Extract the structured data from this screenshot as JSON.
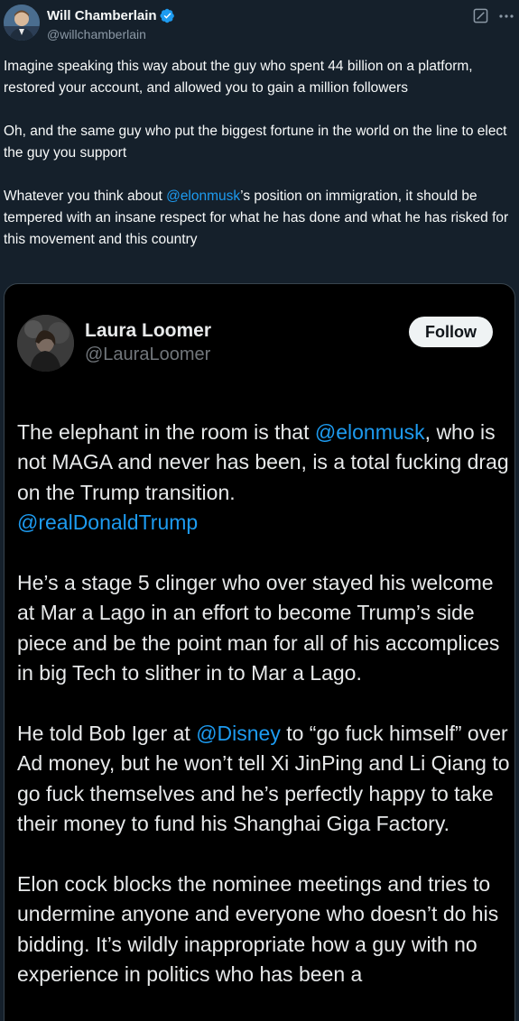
{
  "author": {
    "name": "Will Chamberlain",
    "handle": "@willchamberlain",
    "verified": true,
    "verified_color": "#1d9bf0"
  },
  "header_icons": [
    "grok-icon",
    "more-icon"
  ],
  "post": {
    "p1": "Imagine speaking this way about the guy who spent 44 billion on a platform, restored your account, and allowed you to gain a million followers",
    "p2": "Oh, and the same guy who put the biggest fortune in the world on the line to elect the guy you support",
    "p3_before": "Whatever you think about ",
    "p3_mention": "@elonmusk",
    "p3_after": "’s position on immigration, it should be tempered with an insane respect for what he has done and what he has risked for this movement and this country"
  },
  "embedded": {
    "name": "Laura Loomer",
    "handle": "@LauraLoomer",
    "follow_label": "Follow",
    "p1_before": "The elephant in the room is that ",
    "p1_mention": "@elonmusk",
    "p1_after": ", who is not MAGA and never has been, is a total fucking drag on the Trump transition.",
    "p1_mention2": "@realDonaldTrump",
    "p2": "He’s a stage 5 clinger who over stayed his welcome at Mar a Lago in an effort to become Trump’s side piece and be the point man for all of his accomplices in big Tech to slither in to Mar a Lago.",
    "p3_before": "He told Bob Iger at ",
    "p3_mention": "@Disney",
    "p3_after": " to “go fuck himself” over Ad money, but he won’t tell Xi JinPing and Li Qiang to go fuck themselves and he’s perfectly happy to take their money to fund his Shanghai Giga Factory.",
    "p4": "Elon cock blocks the nominee meetings and tries to undermine anyone and everyone who doesn’t do his bidding. It’s wildly inappropriate how a guy with no experience in politics who has been a"
  },
  "colors": {
    "background": "#15202b",
    "link": "#1d9bf0",
    "card_background": "#000000"
  }
}
